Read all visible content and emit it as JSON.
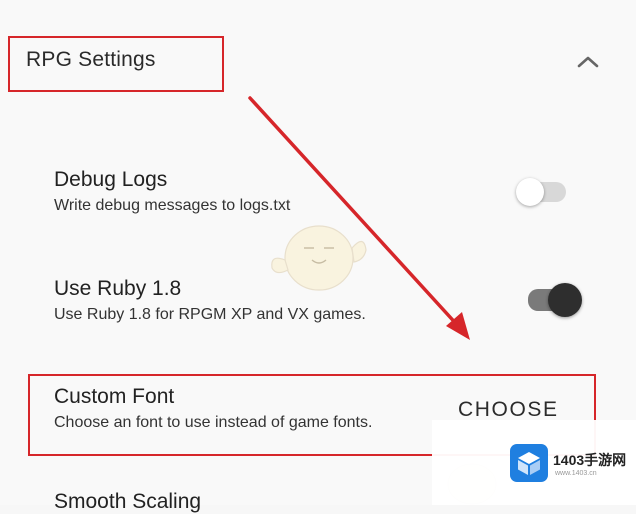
{
  "section": {
    "title": "RPG Settings",
    "collapse_icon": "chevron-up-icon"
  },
  "settings": [
    {
      "title": "Debug Logs",
      "subtitle": "Write debug messages to logs.txt",
      "control": "switch",
      "checked": false
    },
    {
      "title": "Use Ruby 1.8",
      "subtitle": "Use Ruby 1.8 for RPGM XP and VX games.",
      "control": "switch",
      "checked": true
    },
    {
      "title": "Custom Font",
      "subtitle": "Choose an font to use instead of game fonts.",
      "control": "button",
      "button_label": "CHOOSE"
    },
    {
      "title": "Smooth Scaling"
    }
  ],
  "watermark": {
    "name": "1403手游网",
    "url": "www.1403.cn",
    "logo_icon": "cube-icon"
  },
  "colors": {
    "highlight": "#d6262a",
    "arrow": "#d6262a",
    "switch_on_thumb": "#2e2e2e",
    "switch_on_track": "#7a7a7a",
    "switch_off_thumb": "#ffffff",
    "switch_off_track": "#d8d8d8",
    "watermark_logo": "#1f7fe0"
  }
}
